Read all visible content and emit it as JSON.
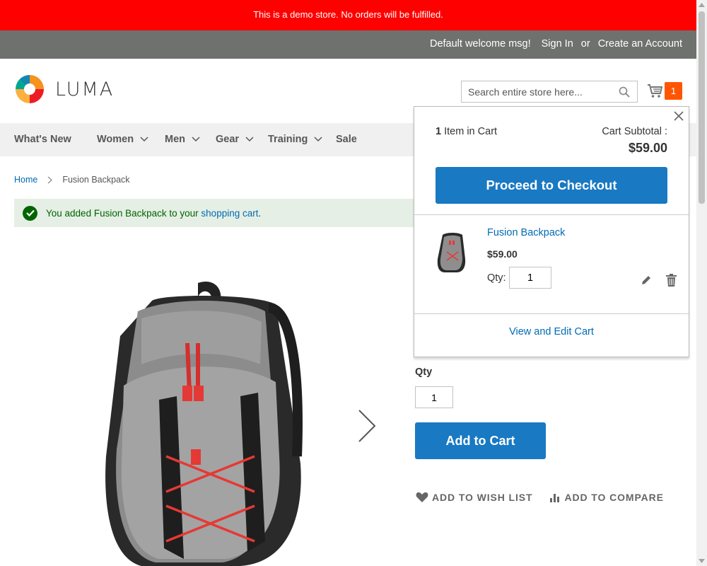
{
  "demo_notice": "This is a demo store. No orders will be fulfilled.",
  "header": {
    "welcome": "Default welcome msg!",
    "sign_in": "Sign In",
    "or": "or",
    "create_account": "Create an Account"
  },
  "logo": {
    "text": "LUMA"
  },
  "search": {
    "placeholder": "Search entire store here..."
  },
  "minicart": {
    "count": "1"
  },
  "nav": {
    "items": [
      {
        "label": "What's New"
      },
      {
        "label": "Women"
      },
      {
        "label": "Men"
      },
      {
        "label": "Gear"
      },
      {
        "label": "Training"
      },
      {
        "label": "Sale"
      }
    ]
  },
  "breadcrumb": {
    "home": "Home",
    "current": "Fusion Backpack"
  },
  "message": {
    "prefix": "You added Fusion Backpack to your",
    "link": "shopping cart",
    "suffix": "."
  },
  "product": {
    "qty_label": "Qty",
    "qty_value": "1",
    "add_to_cart": "Add to Cart",
    "wishlist": "ADD TO WISH LIST",
    "compare": "ADD TO COMPARE"
  },
  "dropdown": {
    "count": "1",
    "items_label": "Item in Cart",
    "subtotal_label": "Cart Subtotal :",
    "subtotal": "$59.00",
    "checkout": "Proceed to Checkout",
    "item": {
      "name": "Fusion Backpack",
      "price": "$59.00",
      "qty_label": "Qty:",
      "qty": "1"
    },
    "view_edit": "View and Edit Cart"
  },
  "colors": {
    "demo_bar": "#ff0000",
    "header_panel": "#6e716e",
    "primary_button": "#1979c3",
    "cart_badge": "#ff5501",
    "link": "#006bb4",
    "success_bg": "#e5efe5"
  }
}
